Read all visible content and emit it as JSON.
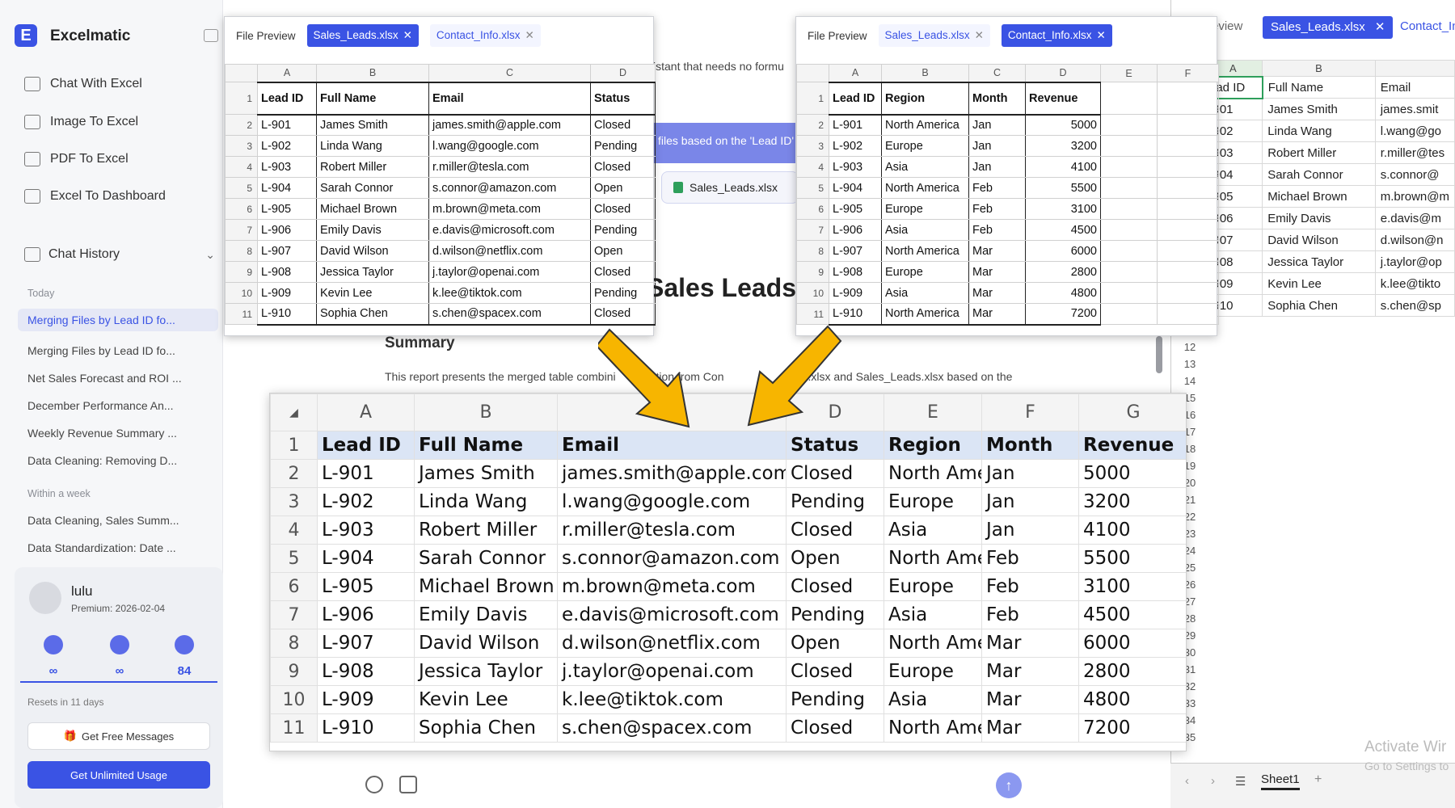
{
  "app": {
    "brand": "Excelmatic",
    "logo_letter": "E",
    "nav": [
      {
        "label": "Chat With Excel",
        "icon": "chat-plus-icon"
      },
      {
        "label": "Image To Excel",
        "icon": "image-icon"
      },
      {
        "label": "PDF To Excel",
        "icon": "pdf-icon"
      },
      {
        "label": "Excel To Dashboard",
        "icon": "dashboard-icon"
      }
    ],
    "chat_history_label": "Chat History",
    "today_label": "Today",
    "week_label": "Within a week",
    "history_today": [
      "Merging Files by Lead ID fo...",
      "Merging Files by Lead ID fo...",
      "Net Sales Forecast and ROI ...",
      "December Performance An...",
      "Weekly Revenue Summary ...",
      "Data Cleaning: Removing D..."
    ],
    "history_week": [
      "Data Cleaning, Sales Summ...",
      "Data Standardization: Date ..."
    ],
    "user": {
      "name": "lulu",
      "premium": "Premium: 2026-02-04",
      "stats": [
        "∞",
        "∞",
        "84"
      ],
      "resets": "Resets in 11 days",
      "free_btn": "Get Free Messages",
      "unlimited_btn": "Get Unlimited Usage"
    }
  },
  "background": {
    "partial_text_1": "istant that needs no formu",
    "partial_text_2": "files based on the 'Lead ID'",
    "chip_file": "Sales_Leads.xlsx",
    "heading": "Sales Leads",
    "summary": "Summary",
    "report_left": "This report presents the merged table combini",
    "report_mid": "mation from Con",
    "report_right": "nfo.xlsx and Sales_Leads.xlsx based on the"
  },
  "right_panel": {
    "tab_partial": "review",
    "tab_active": "Sales_Leads.xlsx",
    "tab_other": "Contact_In",
    "col_a": "A",
    "col_b": "B",
    "headers": [
      "ead ID",
      "Full Name",
      "Email"
    ],
    "rows": [
      [
        "-901",
        "James Smith",
        "james.smit"
      ],
      [
        "-902",
        "Linda Wang",
        "l.wang@go"
      ],
      [
        "-903",
        "Robert Miller",
        "r.miller@tes"
      ],
      [
        "-904",
        "Sarah Connor",
        "s.connor@"
      ],
      [
        "-905",
        "Michael Brown",
        "m.brown@m"
      ],
      [
        "-906",
        "Emily Davis",
        "e.davis@m"
      ],
      [
        "-907",
        "David Wilson",
        "d.wilson@n"
      ],
      [
        "-908",
        "Jessica Taylor",
        "j.taylor@op"
      ],
      [
        "-909",
        "Kevin Lee",
        "k.lee@tikto"
      ],
      [
        "-910",
        "Sophia Chen",
        "s.chen@sp"
      ]
    ],
    "row_numbers": [
      "12",
      "13",
      "14",
      "15",
      "16",
      "17",
      "18",
      "19",
      "20",
      "21",
      "22",
      "23",
      "24",
      "25",
      "26",
      "27",
      "28",
      "29",
      "30",
      "31",
      "32",
      "33",
      "34",
      "35"
    ],
    "sheet_tab": "Sheet1",
    "activate_title": "Activate Wir",
    "activate_sub": "Go to Settings to"
  },
  "preview_sales": {
    "label": "File Preview",
    "tab_active": "Sales_Leads.xlsx",
    "tab_other": "Contact_Info.xlsx",
    "columns": [
      "A",
      "B",
      "C",
      "D"
    ],
    "headers": [
      "Lead ID",
      "Full Name",
      "Email",
      "Status"
    ],
    "rows": [
      [
        "L-901",
        "James Smith",
        "james.smith@apple.com",
        "Closed"
      ],
      [
        "L-902",
        "Linda Wang",
        "l.wang@google.com",
        "Pending"
      ],
      [
        "L-903",
        "Robert Miller",
        "r.miller@tesla.com",
        "Closed"
      ],
      [
        "L-904",
        "Sarah Connor",
        "s.connor@amazon.com",
        "Open"
      ],
      [
        "L-905",
        "Michael Brown",
        "m.brown@meta.com",
        "Closed"
      ],
      [
        "L-906",
        "Emily Davis",
        "e.davis@microsoft.com",
        "Pending"
      ],
      [
        "L-907",
        "David Wilson",
        "d.wilson@netflix.com",
        "Open"
      ],
      [
        "L-908",
        "Jessica Taylor",
        "j.taylor@openai.com",
        "Closed"
      ],
      [
        "L-909",
        "Kevin Lee",
        "k.lee@tiktok.com",
        "Pending"
      ],
      [
        "L-910",
        "Sophia Chen",
        "s.chen@spacex.com",
        "Closed"
      ]
    ]
  },
  "preview_contact": {
    "label": "File Preview",
    "tab_other": "Sales_Leads.xlsx",
    "tab_active": "Contact_Info.xlsx",
    "columns": [
      "A",
      "B",
      "C",
      "D",
      "E",
      "F"
    ],
    "headers": [
      "Lead ID",
      "Region",
      "Month",
      "Revenue"
    ],
    "rows": [
      [
        "L-901",
        "North America",
        "Jan",
        "5000"
      ],
      [
        "L-902",
        "Europe",
        "Jan",
        "3200"
      ],
      [
        "L-903",
        "Asia",
        "Jan",
        "4100"
      ],
      [
        "L-904",
        "North America",
        "Feb",
        "5500"
      ],
      [
        "L-905",
        "Europe",
        "Feb",
        "3100"
      ],
      [
        "L-906",
        "Asia",
        "Feb",
        "4500"
      ],
      [
        "L-907",
        "North America",
        "Mar",
        "6000"
      ],
      [
        "L-908",
        "Europe",
        "Mar",
        "2800"
      ],
      [
        "L-909",
        "Asia",
        "Mar",
        "4800"
      ],
      [
        "L-910",
        "North America",
        "Mar",
        "7200"
      ]
    ]
  },
  "merged": {
    "columns": [
      "A",
      "B",
      "",
      "D",
      "E",
      "F",
      "G"
    ],
    "headers": [
      "Lead ID",
      "Full Name",
      "Email",
      "Status",
      "Region",
      "Month",
      "Revenue"
    ],
    "rows": [
      [
        "L-901",
        "James Smith",
        "james.smith@apple.com",
        "Closed",
        "North Ame",
        "Jan",
        "5000"
      ],
      [
        "L-902",
        "Linda Wang",
        "l.wang@google.com",
        "Pending",
        "Europe",
        "Jan",
        "3200"
      ],
      [
        "L-903",
        "Robert Miller",
        "r.miller@tesla.com",
        "Closed",
        "Asia",
        "Jan",
        "4100"
      ],
      [
        "L-904",
        "Sarah Connor",
        "s.connor@amazon.com",
        "Open",
        "North Ame",
        "Feb",
        "5500"
      ],
      [
        "L-905",
        "Michael Brown",
        "m.brown@meta.com",
        "Closed",
        "Europe",
        "Feb",
        "3100"
      ],
      [
        "L-906",
        "Emily Davis",
        "e.davis@microsoft.com",
        "Pending",
        "Asia",
        "Feb",
        "4500"
      ],
      [
        "L-907",
        "David Wilson",
        "d.wilson@netflix.com",
        "Open",
        "North Ame",
        "Mar",
        "6000"
      ],
      [
        "L-908",
        "Jessica Taylor",
        "j.taylor@openai.com",
        "Closed",
        "Europe",
        "Mar",
        "2800"
      ],
      [
        "L-909",
        "Kevin Lee",
        "k.lee@tiktok.com",
        "Pending",
        "Asia",
        "Mar",
        "4800"
      ],
      [
        "L-910",
        "Sophia Chen",
        "s.chen@spacex.com",
        "Closed",
        "North Ame",
        "Mar",
        "7200"
      ]
    ]
  },
  "colors": {
    "accent": "#3a53e4",
    "arrow": "#f7b500",
    "merged_header": "#dbe5f5"
  }
}
